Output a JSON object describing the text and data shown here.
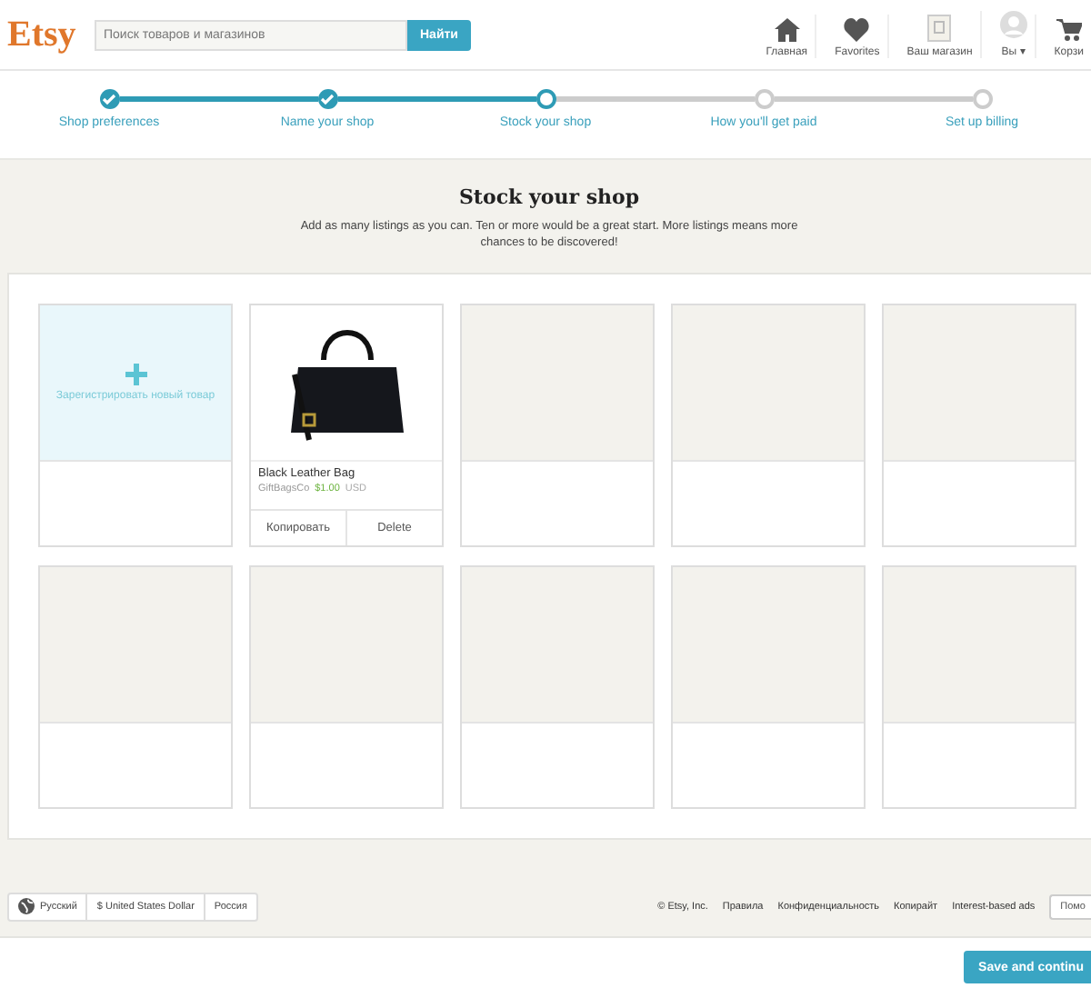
{
  "header": {
    "logo": "Etsy",
    "search": {
      "placeholder": "Поиск товаров и магазинов"
    },
    "search_button": "Найти",
    "nav": [
      {
        "kind": "home",
        "label": "Главная"
      },
      {
        "kind": "heart",
        "label": "Favorites"
      },
      {
        "kind": "shop",
        "label": "Ваш магазин"
      },
      {
        "kind": "avatar",
        "label": "Вы ▾"
      },
      {
        "kind": "cart",
        "label": "Корзи"
      }
    ]
  },
  "steps": [
    {
      "label": "Shop preferences",
      "done": true,
      "current": false
    },
    {
      "label": "Name your shop",
      "done": true,
      "current": false
    },
    {
      "label": "Stock your shop",
      "done": false,
      "current": true
    },
    {
      "label": "How you'll get paid",
      "done": false,
      "current": false
    },
    {
      "label": "Set up billing",
      "done": false,
      "current": false
    }
  ],
  "title": "Stock your shop",
  "subtitle": "Add as many listings as you can. Ten or more would be a great start. More listings means more chances to be discovered!",
  "listings": [
    {
      "kind": "add",
      "label": "Зарегистрировать новый товар"
    },
    {
      "kind": "listing",
      "title": "Black Leather Bag",
      "shop": "GiftBagsCo",
      "price": "$1.00",
      "currency": "USD",
      "actions": [
        "Копировать",
        "Delete"
      ]
    },
    {
      "kind": "empty"
    },
    {
      "kind": "empty"
    },
    {
      "kind": "empty"
    },
    {
      "kind": "empty"
    },
    {
      "kind": "empty"
    },
    {
      "kind": "empty"
    },
    {
      "kind": "empty"
    },
    {
      "kind": "empty"
    }
  ],
  "footer": {
    "locale": [
      "Русский",
      "$ United States Dollar",
      "Россия"
    ],
    "copyright": "© Etsy, Inc.",
    "links": [
      "Правила",
      "Конфиденциальность",
      "Копирайт",
      "Interest-based ads"
    ],
    "help": "Помо"
  },
  "save_button": "Save and continu"
}
